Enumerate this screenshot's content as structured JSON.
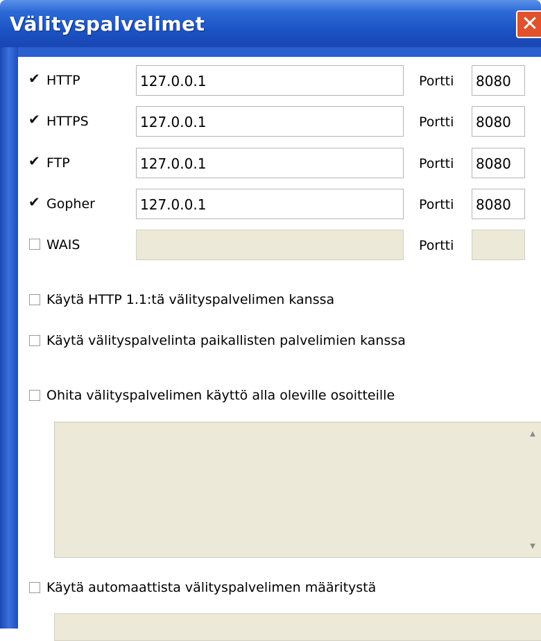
{
  "window": {
    "title": "Välityspalvelimet",
    "close_label": "✕"
  },
  "background": {
    "fragment_top": "t",
    "fragment_dark": "o"
  },
  "proxies": [
    {
      "label": "HTTP",
      "checked": true,
      "address": "127.0.0.1",
      "port_label": "Portti",
      "port": "8080",
      "enabled": true
    },
    {
      "label": "HTTPS",
      "checked": true,
      "address": "127.0.0.1",
      "port_label": "Portti",
      "port": "8080",
      "enabled": true
    },
    {
      "label": "FTP",
      "checked": true,
      "address": "127.0.0.1",
      "port_label": "Portti",
      "port": "8080",
      "enabled": true
    },
    {
      "label": "Gopher",
      "checked": true,
      "address": "127.0.0.1",
      "port_label": "Portti",
      "port": "8080",
      "enabled": true
    },
    {
      "label": "WAIS",
      "checked": false,
      "address": "",
      "port_label": "Portti",
      "port": "",
      "enabled": false
    }
  ],
  "options": {
    "use_http11": {
      "label": "Käytä HTTP 1.1:tä välityspalvelimen kanssa",
      "checked": false
    },
    "use_local": {
      "label": "Käytä välityspalvelinta paikallisten palvelimien kanssa",
      "checked": false
    },
    "bypass": {
      "label": "Ohita välityspalvelimen käyttö alla oleville osoitteille",
      "checked": false,
      "value": ""
    },
    "auto_config": {
      "label": "Käytä automaattista välityspalvelimen määritystä",
      "checked": false
    }
  },
  "colors": {
    "titlebar": "#2c69d6",
    "close": "#e0512c",
    "disabled_field": "#ece9d8"
  }
}
